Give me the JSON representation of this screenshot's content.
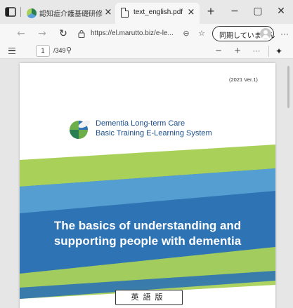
{
  "browser": {
    "tabs": [
      {
        "title": "認知症介護基礎研修 e-",
        "close": "×"
      },
      {
        "title": "text_english.pdf",
        "close": "×"
      }
    ],
    "new_tab": "+",
    "window": {
      "minimize": "−",
      "maximize": "▢",
      "close": "✕"
    },
    "nav": {
      "back": "←",
      "forward": "→",
      "refresh": "↻"
    },
    "url": "https://el.marutto.biz/e-le...",
    "zoom_glyph": "⊖",
    "favorite_glyph": "☆",
    "sync_label": "同期していません",
    "more": "···"
  },
  "pdf_toolbar": {
    "current_page": "1",
    "total_pages": "/349",
    "zoom_out": "−",
    "zoom_in": "+",
    "more": "···",
    "pin": "✦"
  },
  "pdf_page": {
    "version": "(2021 Ver.1)",
    "brand_line1": "Dementia Long-term Care",
    "brand_line2": "Basic Training E-Learning System",
    "headline_line1": "The basics of understanding and",
    "headline_line2": "supporting people with dementia",
    "edition_label": "英語版"
  },
  "colors": {
    "brand_blue": "#1a4e8a",
    "band_blue": "#2e73b4",
    "band_green": "#a9d15a"
  }
}
